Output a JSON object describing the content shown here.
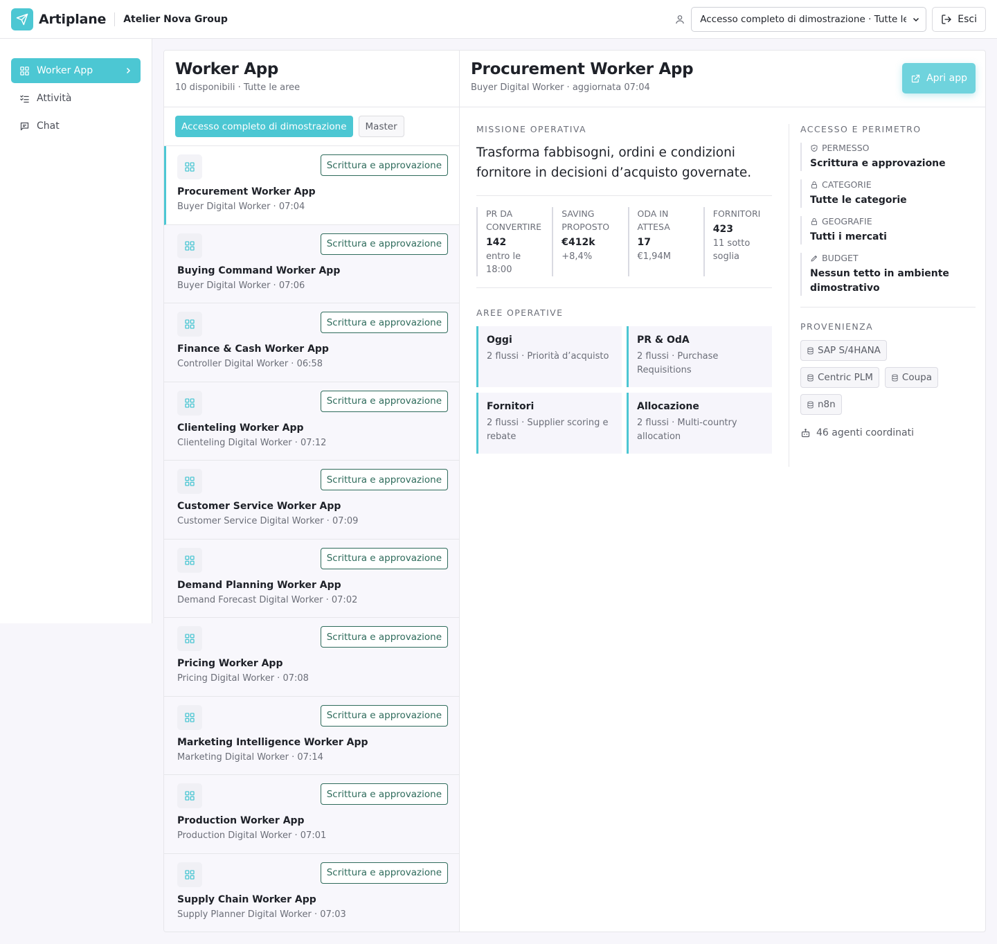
{
  "colors": {
    "accent": "#4cc7d3",
    "badge": "#2e6b5b",
    "text": "#1e2128",
    "muted": "#6b6e78"
  },
  "topbar": {
    "brand": "Artiplane",
    "company": "Atelier Nova Group",
    "scope_value": "Accesso completo di dimostrazione · Tutte le aree",
    "logout_label": "Esci"
  },
  "sidebar": {
    "items": [
      {
        "label": "Worker App",
        "icon": "grid-icon",
        "active": true
      },
      {
        "label": "Attività",
        "icon": "checklist-icon",
        "active": false
      },
      {
        "label": "Chat",
        "icon": "chat-icon",
        "active": false
      }
    ]
  },
  "list": {
    "title": "Worker App",
    "subtitle": "10 disponibili · Tutte le aree",
    "filters": [
      "Accesso completo di dimostrazione",
      "Master"
    ],
    "items": [
      {
        "name": "Procurement Worker App",
        "meta": "Buyer Digital Worker · 07:04",
        "badge": "Scrittura e approvazione"
      },
      {
        "name": "Buying Command Worker App",
        "meta": "Buyer Digital Worker · 07:06",
        "badge": "Scrittura e approvazione"
      },
      {
        "name": "Finance & Cash Worker App",
        "meta": "Controller Digital Worker · 06:58",
        "badge": "Scrittura e approvazione"
      },
      {
        "name": "Clienteling Worker App",
        "meta": "Clienteling Digital Worker · 07:12",
        "badge": "Scrittura e approvazione"
      },
      {
        "name": "Customer Service Worker App",
        "meta": "Customer Service Digital Worker · 07:09",
        "badge": "Scrittura e approvazione"
      },
      {
        "name": "Demand Planning Worker App",
        "meta": "Demand Forecast Digital Worker · 07:02",
        "badge": "Scrittura e approvazione"
      },
      {
        "name": "Pricing Worker App",
        "meta": "Pricing Digital Worker · 07:08",
        "badge": "Scrittura e approvazione"
      },
      {
        "name": "Marketing Intelligence Worker App",
        "meta": "Marketing Digital Worker · 07:14",
        "badge": "Scrittura e approvazione"
      },
      {
        "name": "Production Worker App",
        "meta": "Production Digital Worker · 07:01",
        "badge": "Scrittura e approvazione"
      },
      {
        "name": "Supply Chain Worker App",
        "meta": "Supply Planner Digital Worker · 07:03",
        "badge": "Scrittura e approvazione"
      }
    ]
  },
  "detail": {
    "title": "Procurement Worker App",
    "subtitle": "Buyer Digital Worker · aggiornata 07:04",
    "open_label": "Apri app",
    "mission_label": "Missione operativa",
    "mission": "Trasforma fabbisogni, ordini e condizioni fornitore in decisioni d’acquisto governate.",
    "kpis": [
      {
        "label": "PR da convertire",
        "value": "142",
        "note": "entro le 18:00"
      },
      {
        "label": "Saving proposto",
        "value": "€412k",
        "note": "+8,4%"
      },
      {
        "label": "OdA in attesa",
        "value": "17",
        "note": "€1,94M"
      },
      {
        "label": "Fornitori",
        "value": "423",
        "note": "11 sotto soglia"
      }
    ],
    "areas_label": "Aree operative",
    "areas": [
      {
        "name": "Oggi",
        "desc": "2 flussi · Priorità d’acquisto"
      },
      {
        "name": "PR & OdA",
        "desc": "2 flussi · Purchase Requisitions"
      },
      {
        "name": "Fornitori",
        "desc": "2 flussi · Supplier scoring e rebate"
      },
      {
        "name": "Allocazione",
        "desc": "2 flussi · Multi-country allocation"
      }
    ],
    "access_label": "Accesso e perimetro",
    "access": [
      {
        "label": "Permesso",
        "value": "Scrittura e approvazione",
        "icon": "shield-icon"
      },
      {
        "label": "Categorie",
        "value": "Tutte le categorie",
        "icon": "lock-icon"
      },
      {
        "label": "Geografie",
        "value": "Tutti i mercati",
        "icon": "lock-icon"
      },
      {
        "label": "Budget",
        "value": "Nessun tetto in ambiente dimostrativo",
        "icon": "pencil-icon"
      }
    ],
    "sources_label": "Provenienza",
    "sources": [
      "SAP S/4HANA",
      "Centric PLM",
      "Coupa",
      "n8n"
    ],
    "agents": "46 agenti coordinati"
  }
}
